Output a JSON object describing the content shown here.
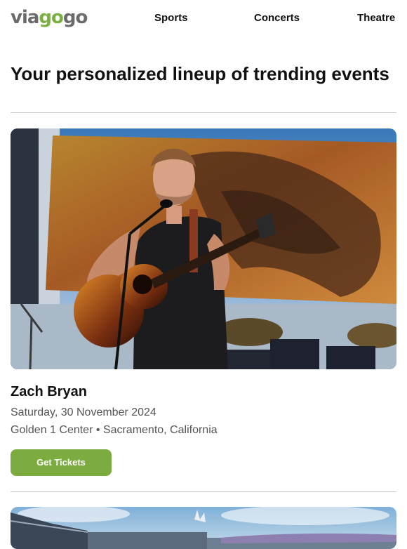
{
  "header": {
    "logo": {
      "part1": "via",
      "part2": "go",
      "part3": "go"
    },
    "nav": [
      {
        "label": "Sports"
      },
      {
        "label": "Concerts"
      },
      {
        "label": "Theatre"
      }
    ]
  },
  "headline": "Your personalized lineup of trending events",
  "events": [
    {
      "title": "Zach Bryan",
      "date": "Saturday, 30 November 2024",
      "venue": "Golden 1 Center • Sacramento, California",
      "button_label": "Get Tickets",
      "image": "performer-with-guitar-photo"
    },
    {
      "image": "stadium-photo"
    }
  ],
  "colors": {
    "brand_green": "#7cac3f",
    "brand_grey": "#6b6b6b",
    "divider": "#c9c9c9",
    "secondary_text": "#555555"
  }
}
